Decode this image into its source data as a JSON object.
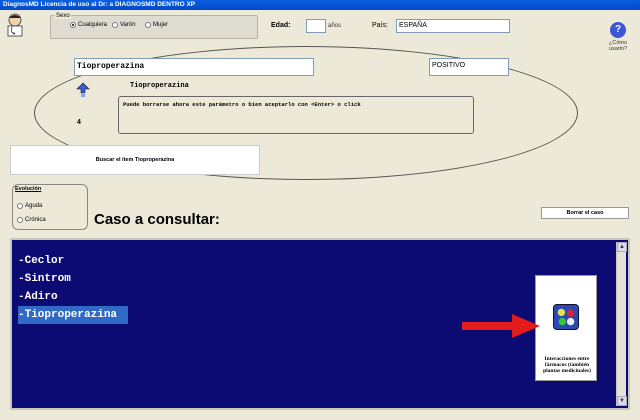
{
  "window": {
    "title": "DiagnosMD Licencia de uso al Dr: a DIAGNOSMD DENTRO XP"
  },
  "sexo": {
    "label": "Sexo",
    "options": [
      "Cualquiera",
      "Varón",
      "Mujer"
    ],
    "selected": "Cualquiera"
  },
  "edad": {
    "label": "Edad:",
    "value": "",
    "unit": "años"
  },
  "pais": {
    "label": "País:",
    "value": "ESPAÑA"
  },
  "help": {
    "label": "¿Cómo usarlo?"
  },
  "drug_input": {
    "value": "Tioproperazina"
  },
  "result_field": {
    "value": "POSITIVO"
  },
  "drug_subtitle": "Tioproperazina",
  "counter": "4",
  "message": "Puede borrarse ahora este parámetro o bien aceptarlo con <Enter> o click",
  "search_box": {
    "label": "Buscar el ítem Tioproperazina"
  },
  "evolucion": {
    "title": "Evolución",
    "options": [
      "Aguda",
      "Crónica"
    ]
  },
  "caso": {
    "title": "Caso a consultar:",
    "clear_button": "Borrar el caso"
  },
  "case_items": [
    "-Ceclor",
    "-Sintrom",
    "-Adiro",
    "-Tioproperazina"
  ],
  "selected_case_item": "-Tioproperazina",
  "interactions_card": {
    "label": "Interacciones entre fármacos (también plantas medicinales)"
  },
  "colors": {
    "panel_bg": "#0b0b73",
    "selection": "#3169c6",
    "arrow": "#e21b1b",
    "titlebar": "#0a5fe0"
  }
}
